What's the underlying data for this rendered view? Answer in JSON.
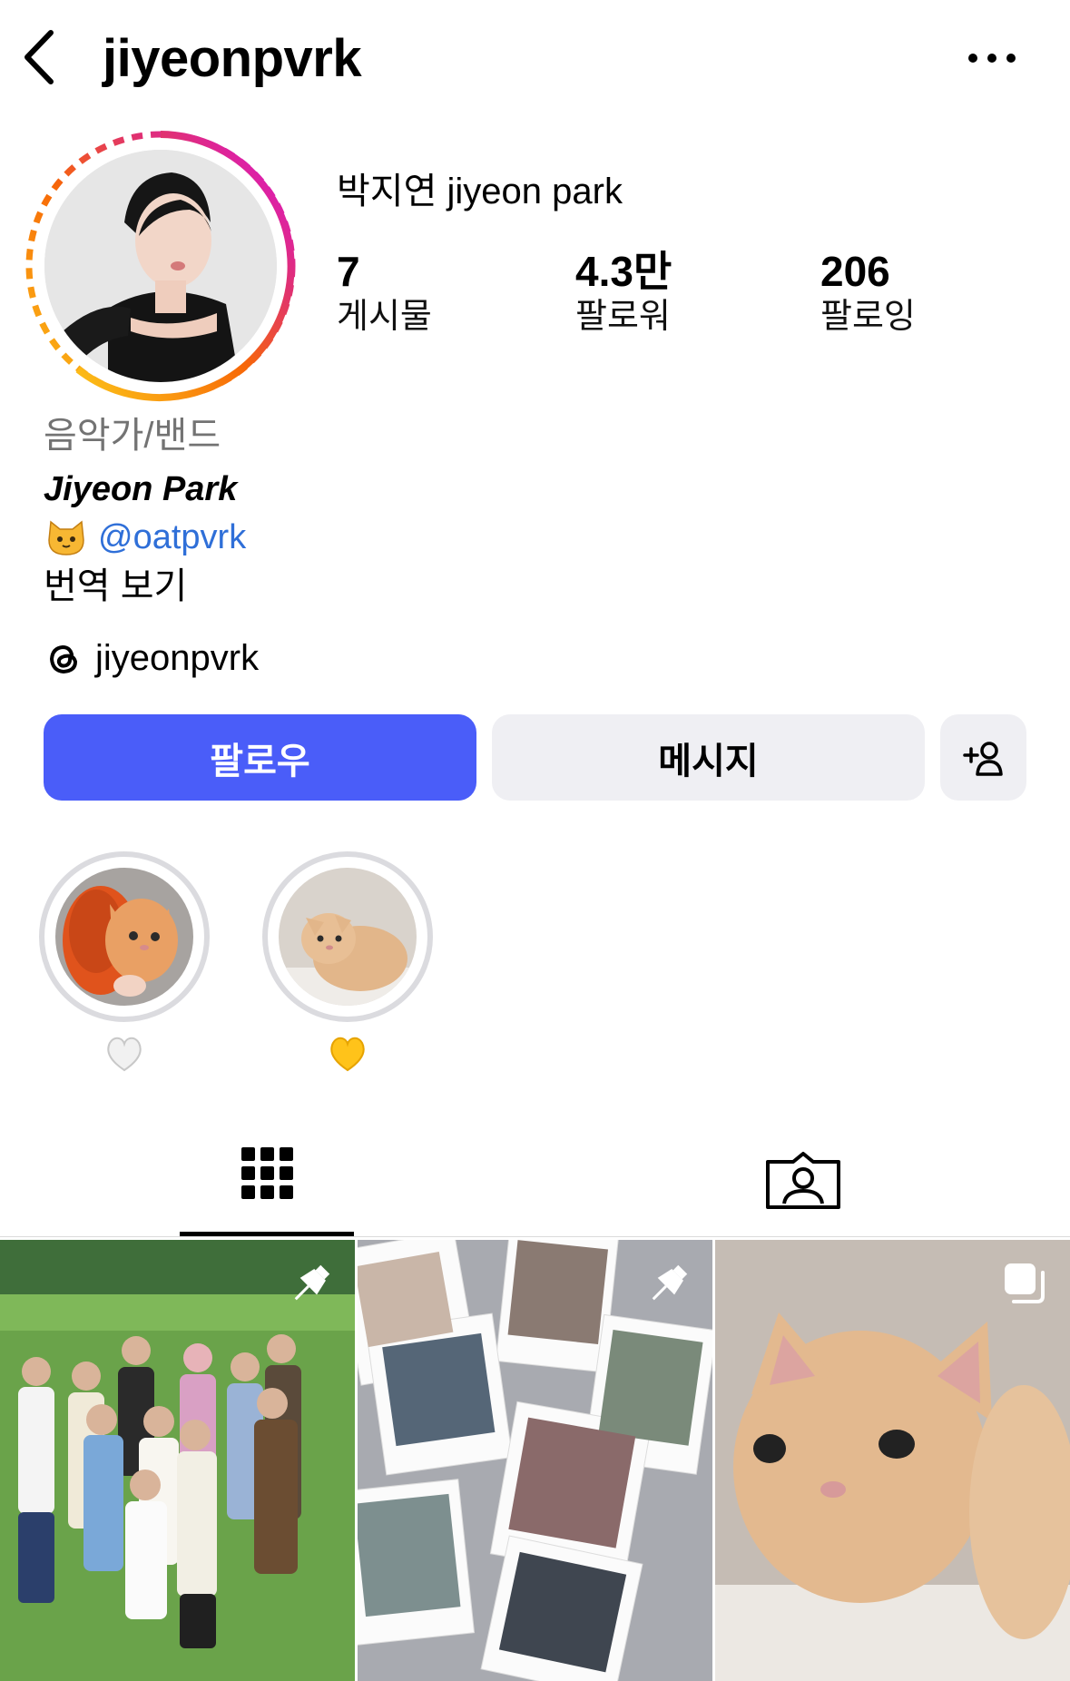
{
  "header": {
    "username": "jiyeonpvrk"
  },
  "profile": {
    "display_name": "박지연 jiyeon park",
    "stats": [
      {
        "value": "7",
        "label": "게시물"
      },
      {
        "value": "4.3만",
        "label": "팔로워"
      },
      {
        "value": "206",
        "label": "팔로잉"
      }
    ]
  },
  "bio": {
    "category": "음악가/밴드",
    "name": "Jiyeon Park",
    "emoji": "cat-face-emoji",
    "mention": "@oatpvrk",
    "translate": "번역 보기",
    "threads_handle": "jiyeonpvrk"
  },
  "buttons": {
    "follow": "팔로우",
    "message": "메시지",
    "suggest_icon": "add-person-icon"
  },
  "highlights": [
    {
      "emoji": "white-heart"
    },
    {
      "emoji": "yellow-heart"
    }
  ],
  "tabs": [
    {
      "icon": "grid-icon",
      "active": true
    },
    {
      "icon": "tagged-icon",
      "active": false
    }
  ],
  "posts": [
    {
      "badge": "pin-icon"
    },
    {
      "badge": "pin-icon"
    },
    {
      "badge": "carousel-icon"
    }
  ],
  "colors": {
    "follow_button": "#4a5df9",
    "secondary_button": "#efeff3",
    "mention": "#2f6fd8",
    "category": "#737373"
  }
}
